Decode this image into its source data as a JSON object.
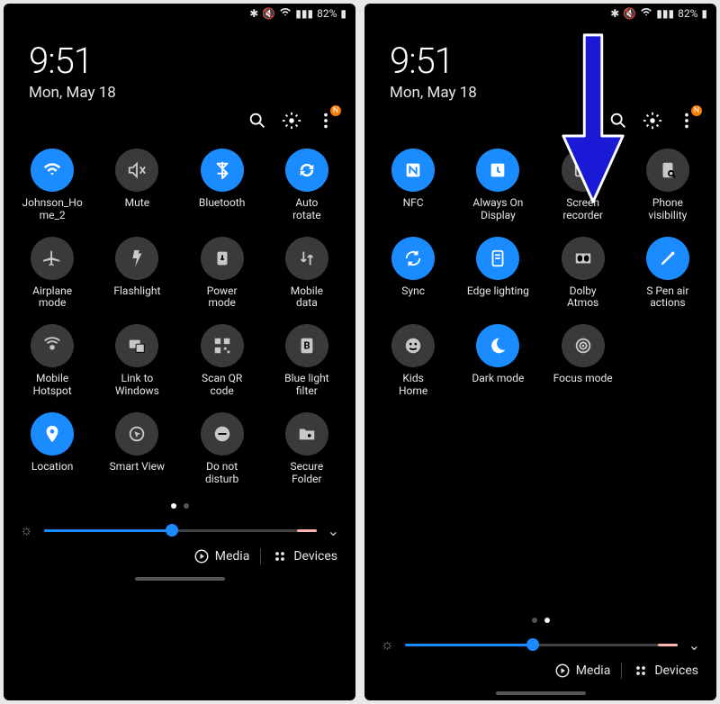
{
  "status_bar": {
    "battery_pct": "82%"
  },
  "header": {
    "time": "9:51",
    "date": "Mon, May 18"
  },
  "action_row": {
    "badge_letter": "N"
  },
  "left_panel": {
    "tiles": [
      {
        "id": "wifi",
        "label": "Johnson_Ho\nme_2",
        "on": true
      },
      {
        "id": "mute",
        "label": "Mute",
        "on": false
      },
      {
        "id": "bluetooth",
        "label": "Bluetooth",
        "on": true
      },
      {
        "id": "autorotate",
        "label": "Auto\nrotate",
        "on": true
      },
      {
        "id": "airplane",
        "label": "Airplane\nmode",
        "on": false
      },
      {
        "id": "flashlight",
        "label": "Flashlight",
        "on": false
      },
      {
        "id": "power",
        "label": "Power\nmode",
        "on": false
      },
      {
        "id": "mobiledata",
        "label": "Mobile\ndata",
        "on": false
      },
      {
        "id": "hotspot",
        "label": "Mobile\nHotspot",
        "on": false
      },
      {
        "id": "linkwin",
        "label": "Link to\nWindows",
        "on": false
      },
      {
        "id": "qr",
        "label": "Scan QR\ncode",
        "on": false
      },
      {
        "id": "bluelight",
        "label": "Blue light\nfilter",
        "on": false
      },
      {
        "id": "location",
        "label": "Location",
        "on": true
      },
      {
        "id": "smartview",
        "label": "Smart View",
        "on": false
      },
      {
        "id": "dnd",
        "label": "Do not\ndisturb",
        "on": false
      },
      {
        "id": "secure",
        "label": "Secure\nFolder",
        "on": false
      }
    ],
    "page_active": 0
  },
  "right_panel": {
    "tiles": [
      {
        "id": "nfc",
        "label": "NFC",
        "on": true
      },
      {
        "id": "aod",
        "label": "Always On\nDisplay",
        "on": true
      },
      {
        "id": "screenrec",
        "label": "Screen\nrecorder",
        "on": false
      },
      {
        "id": "phonevis",
        "label": "Phone\nvisibility",
        "on": false
      },
      {
        "id": "sync",
        "label": "Sync",
        "on": true
      },
      {
        "id": "edge",
        "label": "Edge lighting",
        "on": true
      },
      {
        "id": "dolby",
        "label": "Dolby\nAtmos",
        "on": false
      },
      {
        "id": "spen",
        "label": "S Pen air\nactions",
        "on": true
      },
      {
        "id": "kids",
        "label": "Kids\nHome",
        "on": false
      },
      {
        "id": "dark",
        "label": "Dark mode",
        "on": true
      },
      {
        "id": "focus",
        "label": "Focus mode",
        "on": false
      }
    ],
    "page_active": 1
  },
  "slider": {
    "pct": 47
  },
  "bottom": {
    "media": "Media",
    "devices": "Devices"
  },
  "annotation": {
    "arrow_color": "#1a1ad6"
  }
}
